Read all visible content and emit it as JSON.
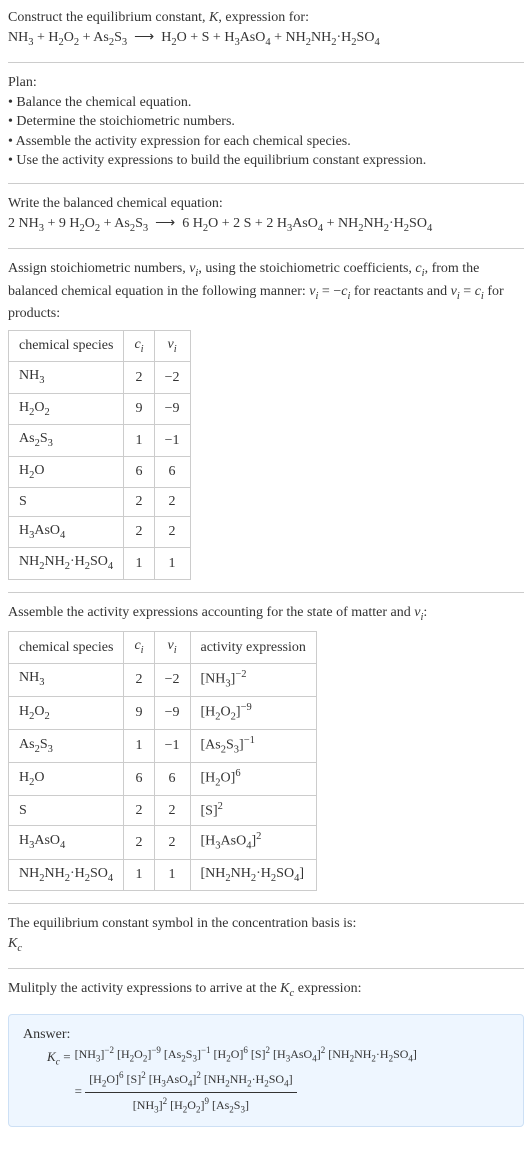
{
  "intro": {
    "line1_prefix": "Construct the equilibrium constant, ",
    "line1_italic": "K",
    "line1_suffix": ", expression for:"
  },
  "unbalanced": {
    "r1": "NH",
    "r1_sub": "3",
    "r2": "H",
    "r2_sub1": "2",
    "r2_mid": "O",
    "r2_sub2": "2",
    "r3": "As",
    "r3_sub1": "2",
    "r3_mid": "S",
    "r3_sub2": "3",
    "arrow": "⟶",
    "p1": "H",
    "p1_sub": "2",
    "p1_mid": "O",
    "p2": "S",
    "p3": "H",
    "p3_sub1": "3",
    "p3_mid": "AsO",
    "p3_sub2": "4",
    "p4a": "NH",
    "p4a_sub": "2",
    "p4b": "NH",
    "p4b_sub": "2",
    "dot": "·",
    "p4c": "H",
    "p4c_sub": "2",
    "p4d": "SO",
    "p4d_sub": "4",
    "plus": " + "
  },
  "plan": {
    "title": "Plan:",
    "step1": "• Balance the chemical equation.",
    "step2": "• Determine the stoichiometric numbers.",
    "step3": "• Assemble the activity expression for each chemical species.",
    "step4": "• Use the activity expressions to build the equilibrium constant expression."
  },
  "balanced": {
    "heading": "Write the balanced chemical equation:",
    "c1": "2 ",
    "c2": "9 ",
    "c3": "",
    "c4": "6 ",
    "c5": "2 ",
    "c6": "2 ",
    "c7": ""
  },
  "assign": {
    "text_prefix": "Assign stoichiometric numbers, ",
    "nu_i": "ν",
    "nu_sub": "i",
    "text_mid1": ", using the stoichiometric coefficients, ",
    "c_i": "c",
    "c_sub": "i",
    "text_mid2": ", from the balanced chemical equation in the following manner: ",
    "eq1_lhs": "ν",
    "eq1_lhs_sub": "i",
    "eq1_eq": " = −",
    "eq1_rhs": "c",
    "eq1_rhs_sub": "i",
    "text_mid3": " for reactants and ",
    "eq2_lhs": "ν",
    "eq2_lhs_sub": "i",
    "eq2_eq": " = ",
    "eq2_rhs": "c",
    "eq2_rhs_sub": "i",
    "text_mid4": " for products:"
  },
  "table1": {
    "h1": "chemical species",
    "h2": "c",
    "h2_sub": "i",
    "h3": "ν",
    "h3_sub": "i",
    "rows": [
      {
        "sp": "NH",
        "sp_sub": "3",
        "c": "2",
        "v": "−2"
      },
      {
        "sp": "H",
        "sp_sub": "2",
        "sp2": "O",
        "sp2_sub": "2",
        "c": "9",
        "v": "−9"
      },
      {
        "sp": "As",
        "sp_sub": "2",
        "sp2": "S",
        "sp2_sub": "3",
        "c": "1",
        "v": "−1"
      },
      {
        "sp": "H",
        "sp_sub": "2",
        "sp2": "O",
        "c": "6",
        "v": "6"
      },
      {
        "sp": "S",
        "c": "2",
        "v": "2"
      },
      {
        "sp": "H",
        "sp_sub": "3",
        "sp2": "AsO",
        "sp2_sub": "4",
        "c": "2",
        "v": "2"
      },
      {
        "sp": "NH",
        "sp_sub": "2",
        "sp2": "NH",
        "sp2_sub": "2",
        "dot": "·",
        "sp3": "H",
        "sp3_sub": "2",
        "sp4": "SO",
        "sp4_sub": "4",
        "c": "1",
        "v": "1"
      }
    ]
  },
  "assemble_text": {
    "prefix": "Assemble the activity expressions accounting for the state of matter and ",
    "nu": "ν",
    "nu_sub": "i",
    "suffix": ":"
  },
  "table2": {
    "h1": "chemical species",
    "h2": "c",
    "h2_sub": "i",
    "h3": "ν",
    "h3_sub": "i",
    "h4": "activity expression",
    "rows": [
      {
        "sp": "NH",
        "sp_sub": "3",
        "c": "2",
        "v": "−2",
        "ae_base": "[NH",
        "ae_sub": "3",
        "ae_close": "]",
        "ae_sup": "−2"
      },
      {
        "sp": "H",
        "sp_sub": "2",
        "sp2": "O",
        "sp2_sub": "2",
        "c": "9",
        "v": "−9",
        "ae_base": "[H",
        "ae_sub": "2",
        "ae_mid": "O",
        "ae_sub2": "2",
        "ae_close": "]",
        "ae_sup": "−9"
      },
      {
        "sp": "As",
        "sp_sub": "2",
        "sp2": "S",
        "sp2_sub": "3",
        "c": "1",
        "v": "−1",
        "ae_base": "[As",
        "ae_sub": "2",
        "ae_mid": "S",
        "ae_sub2": "3",
        "ae_close": "]",
        "ae_sup": "−1"
      },
      {
        "sp": "H",
        "sp_sub": "2",
        "sp2": "O",
        "c": "6",
        "v": "6",
        "ae_base": "[H",
        "ae_sub": "2",
        "ae_mid": "O]",
        "ae_sup": "6"
      },
      {
        "sp": "S",
        "c": "2",
        "v": "2",
        "ae_base": "[S]",
        "ae_sup": "2"
      },
      {
        "sp": "H",
        "sp_sub": "3",
        "sp2": "AsO",
        "sp2_sub": "4",
        "c": "2",
        "v": "2",
        "ae_base": "[H",
        "ae_sub": "3",
        "ae_mid": "AsO",
        "ae_sub2": "4",
        "ae_close": "]",
        "ae_sup": "2"
      },
      {
        "sp": "NH",
        "sp_sub": "2",
        "sp2": "NH",
        "sp2_sub": "2",
        "dot": "·",
        "sp3": "H",
        "sp3_sub": "2",
        "sp4": "SO",
        "sp4_sub": "4",
        "c": "1",
        "v": "1",
        "ae_full": "[NH",
        "ae_s1": "2",
        "ae_m1": "NH",
        "ae_s2": "2",
        "ae_dot": "·H",
        "ae_s3": "2",
        "ae_m2": "SO",
        "ae_s4": "4",
        "ae_end": "]"
      }
    ]
  },
  "conc_text": {
    "line1": "The equilibrium constant symbol in the concentration basis is:",
    "symbol": "K",
    "symbol_sub": "c"
  },
  "mult_text": {
    "prefix": "Mulitply the activity expressions to arrive at the ",
    "kc": "K",
    "kc_sub": "c",
    "suffix": " expression:"
  },
  "answer": {
    "label": "Answer:",
    "kc": "K",
    "kc_sub": "c",
    "eq": " = "
  },
  "chart_data": {
    "type": "table",
    "title": "Stoichiometric numbers",
    "headers": [
      "chemical species",
      "c_i",
      "ν_i"
    ],
    "rows": [
      [
        "NH3",
        2,
        -2
      ],
      [
        "H2O2",
        9,
        -9
      ],
      [
        "As2S3",
        1,
        -1
      ],
      [
        "H2O",
        6,
        6
      ],
      [
        "S",
        2,
        2
      ],
      [
        "H3AsO4",
        2,
        2
      ],
      [
        "NH2NH2·H2SO4",
        1,
        1
      ]
    ],
    "activity_expressions": [
      "[NH3]^-2",
      "[H2O2]^-9",
      "[As2S3]^-1",
      "[H2O]^6",
      "[S]^2",
      "[H3AsO4]^2",
      "[NH2NH2·H2SO4]"
    ],
    "balanced_equation": "2 NH3 + 9 H2O2 + As2S3 ⟶ 6 H2O + 2 S + 2 H3AsO4 + NH2NH2·H2SO4",
    "Kc_expression": "([H2O]^6 [S]^2 [H3AsO4]^2 [NH2NH2·H2SO4]) / ([NH3]^2 [H2O2]^9 [As2S3])"
  }
}
